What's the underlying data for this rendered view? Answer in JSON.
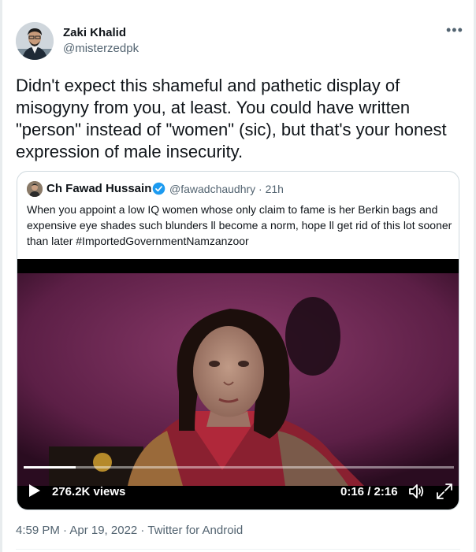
{
  "author": {
    "name": "Zaki Khalid",
    "handle": "@misterzedpk"
  },
  "more_icon": "more-horizontal-icon",
  "tweet": {
    "text": "Didn't expect this shameful and pathetic display of misogyny from you, at least. You could have written \"person\" instead of \"women\" (sic), but that's your honest expression of male insecurity."
  },
  "quoted": {
    "name": "Ch Fawad Hussain",
    "handle_time": "@fawadchaudhry · 21h",
    "text": "When you appoint a low IQ women whose only claim to fame is her Berkin bags and expensive eye shades such blunders ll become a norm, hope ll get rid of this lot sooner than later #ImportedGovernmentNamzanzoor",
    "video": {
      "views": "276.2K views",
      "time": "0:16 / 2:16",
      "progress": 0.12
    }
  },
  "meta": {
    "timestamp": "4:59 PM · Apr 19, 2022 · Twitter for Android"
  },
  "colors": {
    "verified": "#1d9bf0",
    "secondary_text": "#536471",
    "border": "#cfd9de"
  }
}
